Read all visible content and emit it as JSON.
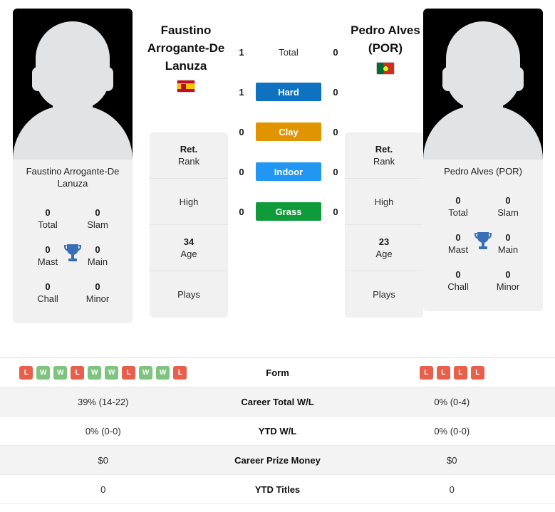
{
  "players": {
    "left": {
      "name": "Faustino Arrogante-De Lanuza",
      "caption": "Faustino Arrogante-De Lanuza",
      "country_code": "ESP",
      "flag": "flag-spain",
      "rank_value": "Ret.",
      "rank_label": "Rank",
      "high_value": "",
      "high_label": "High",
      "age_value": "34",
      "age_label": "Age",
      "plays_value": "",
      "plays_label": "Plays",
      "titles": [
        {
          "value": "0",
          "label": "Total"
        },
        {
          "value": "0",
          "label": "Slam"
        },
        {
          "value": "0",
          "label": "Mast"
        },
        {
          "value": "0",
          "label": "Main"
        },
        {
          "value": "0",
          "label": "Chall"
        },
        {
          "value": "0",
          "label": "Minor"
        }
      ],
      "form": [
        "L",
        "W",
        "W",
        "L",
        "W",
        "W",
        "L",
        "W",
        "W",
        "L"
      ],
      "career_total_wl": "39% (14-22)",
      "ytd_wl": "0% (0-0)",
      "career_prize_money": "$0",
      "ytd_titles": "0"
    },
    "right": {
      "name": "Pedro Alves (POR)",
      "caption": "Pedro Alves (POR)",
      "country_code": "POR",
      "flag": "flag-portugal",
      "rank_value": "Ret.",
      "rank_label": "Rank",
      "high_value": "",
      "high_label": "High",
      "age_value": "23",
      "age_label": "Age",
      "plays_value": "",
      "plays_label": "Plays",
      "titles": [
        {
          "value": "0",
          "label": "Total"
        },
        {
          "value": "0",
          "label": "Slam"
        },
        {
          "value": "0",
          "label": "Mast"
        },
        {
          "value": "0",
          "label": "Main"
        },
        {
          "value": "0",
          "label": "Chall"
        },
        {
          "value": "0",
          "label": "Minor"
        }
      ],
      "form": [
        "L",
        "L",
        "L",
        "L"
      ],
      "career_total_wl": "0% (0-4)",
      "ytd_wl": "0% (0-0)",
      "career_prize_money": "$0",
      "ytd_titles": "0"
    }
  },
  "surfaces": [
    {
      "label": "Total",
      "left": "1",
      "right": "0",
      "color": "none"
    },
    {
      "label": "Hard",
      "left": "1",
      "right": "0",
      "color": "#0e72c0"
    },
    {
      "label": "Clay",
      "left": "0",
      "right": "0",
      "color": "#e09400"
    },
    {
      "label": "Indoor",
      "left": "0",
      "right": "0",
      "color": "#2196f3"
    },
    {
      "label": "Grass",
      "left": "0",
      "right": "0",
      "color": "#109b3b"
    }
  ],
  "stats_table": {
    "rows": [
      {
        "label": "Form",
        "left": "",
        "right": ""
      },
      {
        "label": "Career Total W/L",
        "left": "39% (14-22)",
        "right": "0% (0-4)"
      },
      {
        "label": "YTD W/L",
        "left": "0% (0-0)",
        "right": "0% (0-0)"
      },
      {
        "label": "Career Prize Money",
        "left": "$0",
        "right": "$0"
      },
      {
        "label": "YTD Titles",
        "left": "0",
        "right": "0"
      }
    ]
  },
  "colors": {
    "form_win": "#7fc47e",
    "form_loss": "#e8604c",
    "card_bg": "#f1f1f1",
    "row_shade": "#f3f3f3",
    "trophy": "#3a6fb5"
  }
}
